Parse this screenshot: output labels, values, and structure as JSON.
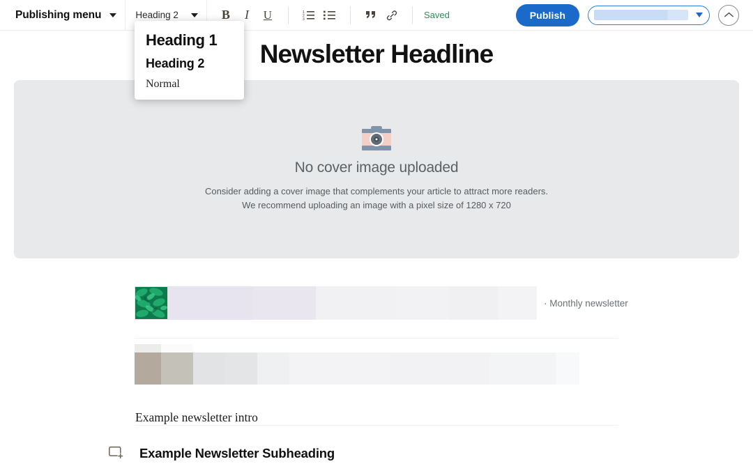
{
  "toolbar": {
    "publishing_menu_label": "Publishing menu",
    "publishing_menu_icon": "chevron-down-icon",
    "style_selector_value": "Heading 2",
    "style_selector_icon": "chevron-down-icon",
    "format_buttons": [
      {
        "name": "bold-button",
        "glyph": "B",
        "label": "B"
      },
      {
        "name": "italic-button",
        "glyph": "I",
        "label": "I"
      },
      {
        "name": "underline-button",
        "glyph": "U",
        "label": "U"
      }
    ],
    "list_buttons": [
      {
        "name": "ordered-list-button",
        "icon": "ordered-list-icon"
      },
      {
        "name": "unordered-list-button",
        "icon": "bulleted-list-icon"
      }
    ],
    "insert_buttons": [
      {
        "name": "blockquote-button",
        "icon": "quote-icon"
      },
      {
        "name": "link-button",
        "icon": "link-icon"
      }
    ],
    "save_status": "Saved",
    "save_status_color": "#2e8b57",
    "publish_label": "Publish",
    "publish_color": "#1b6ac9",
    "publish_target_icon": "chevron-down-icon",
    "collapse_icon": "chevron-up-icon"
  },
  "style_menu": {
    "items": [
      {
        "label": "Heading 1",
        "style": "h1"
      },
      {
        "label": "Heading 2",
        "style": "h2"
      },
      {
        "label": "Normal",
        "style": "normal"
      }
    ]
  },
  "document": {
    "headline": "Newsletter Headline",
    "cover": {
      "icon": "camera-icon",
      "title": "No cover image uploaded",
      "line1": "Consider adding a cover image that complements your article to attract more readers.",
      "line2": "We recommend uploading an image with a pixel size of 1280 x 720",
      "background_color": "#e8e9ea"
    },
    "blocks": [
      {
        "type": "embed-card",
        "thumbnail": "green-foliage-thumbnail",
        "caption": "· Monthly newsletter"
      },
      {
        "type": "embed-card-loading",
        "caption": ""
      },
      {
        "type": "paragraph",
        "text": "Example newsletter intro"
      },
      {
        "type": "heading",
        "text": "Example Newsletter Subheading",
        "gutter_icon": "add-block-icon"
      }
    ]
  }
}
